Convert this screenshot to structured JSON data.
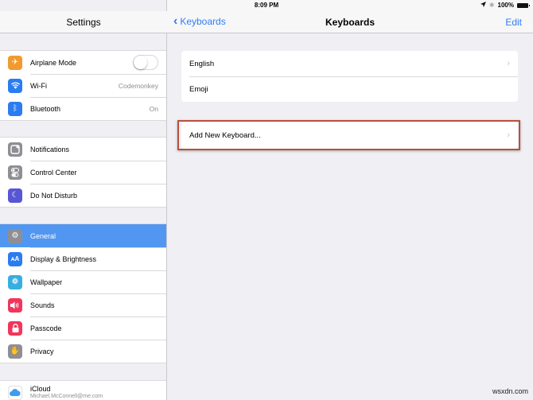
{
  "statusbar": {
    "device": "iPad",
    "time": "8:09 PM",
    "battery": "100%",
    "icons": [
      "wifi-icon",
      "location-icon",
      "bluetooth-icon",
      "battery-icon"
    ]
  },
  "sidebar": {
    "title": "Settings",
    "groups": [
      [
        {
          "label": "Airplane Mode",
          "icon": "airplane-icon",
          "color": "#f19a2f",
          "toggle": false
        },
        {
          "label": "Wi-Fi",
          "icon": "wifi-icon",
          "color": "#2b7cf0",
          "value": "Codemonkey"
        },
        {
          "label": "Bluetooth",
          "icon": "bluetooth-icon",
          "color": "#2b7cf0",
          "value": "On"
        }
      ],
      [
        {
          "label": "Notifications",
          "icon": "notifications-icon",
          "color": "#8e8e93"
        },
        {
          "label": "Control Center",
          "icon": "control-center-icon",
          "color": "#8e8e93"
        },
        {
          "label": "Do Not Disturb",
          "icon": "moon-icon",
          "color": "#5856d6"
        }
      ],
      [
        {
          "label": "General",
          "icon": "gear-icon",
          "color": "#8e8e93",
          "selected": true
        },
        {
          "label": "Display & Brightness",
          "icon": "display-brightness-icon",
          "color": "#2b7cf0"
        },
        {
          "label": "Wallpaper",
          "icon": "wallpaper-icon",
          "color": "#38aee0"
        },
        {
          "label": "Sounds",
          "icon": "speaker-icon",
          "color": "#f2355b"
        },
        {
          "label": "Passcode",
          "icon": "lock-icon",
          "color": "#f2355b"
        },
        {
          "label": "Privacy",
          "icon": "hand-icon",
          "color": "#8e8e93"
        }
      ],
      [
        {
          "label": "iCloud",
          "sub": "Michael.McConnell@me.com",
          "icon": "icloud-icon",
          "color": "#ffffff"
        }
      ]
    ]
  },
  "detail": {
    "back_label": "Keyboards",
    "title": "Keyboards",
    "edit_label": "Edit",
    "keyboards": [
      {
        "label": "English",
        "chevron": true
      },
      {
        "label": "Emoji",
        "chevron": false
      }
    ],
    "add_label": "Add New Keyboard..."
  },
  "watermark": "wsxdn.com"
}
